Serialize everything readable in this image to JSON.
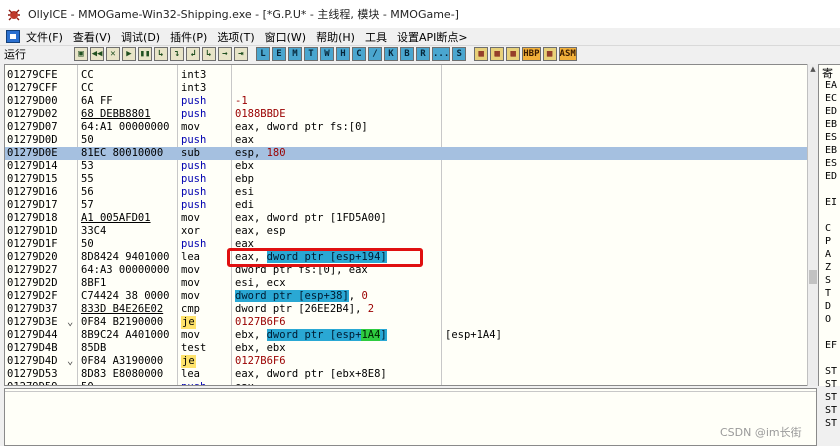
{
  "window": {
    "title": "OllyICE - MMOGame-Win32-Shipping.exe - [*G.P.U* - 主线程, 模块 - MMOGame-]"
  },
  "menu": [
    {
      "id": "file",
      "label": "文件(F)"
    },
    {
      "id": "view",
      "label": "查看(V)"
    },
    {
      "id": "debug",
      "label": "调试(D)"
    },
    {
      "id": "plugins",
      "label": "插件(P)"
    },
    {
      "id": "options",
      "label": "选项(T)"
    },
    {
      "id": "window",
      "label": "窗口(W)"
    },
    {
      "id": "help",
      "label": "帮助(H)"
    },
    {
      "id": "tools",
      "label": "工具"
    },
    {
      "id": "api",
      "label": "设置API断点>"
    }
  ],
  "toolbar": {
    "status": "运行",
    "play_buttons": [
      "▣",
      "◀◀",
      "✕",
      "▶",
      "▮▮",
      "↳",
      "↴",
      "↲",
      "↳",
      "→",
      "⇥"
    ],
    "letter_buttons": [
      "L",
      "E",
      "M",
      "T",
      "W",
      "H",
      "C",
      "/",
      "K",
      "B",
      "R",
      "...",
      "S"
    ],
    "misc_buttons": [
      "▦",
      "▦",
      "▦",
      "HBP",
      "▦",
      "ASM"
    ]
  },
  "disasm": [
    {
      "addr": "01279CFE",
      "arrow": "",
      "hex": "CC",
      "mn": "int3",
      "mn_class": "",
      "ops": [],
      "cmt": ""
    },
    {
      "addr": "01279CFF",
      "arrow": "",
      "hex": "CC",
      "mn": "int3",
      "mn_class": "",
      "ops": [],
      "cmt": ""
    },
    {
      "addr": "01279D00",
      "arrow": "",
      "hex": "6A FF",
      "mn": "push",
      "mn_class": "push",
      "ops": [
        {
          "t": "-1",
          "c": "op-num"
        }
      ],
      "cmt": ""
    },
    {
      "addr": "01279D02",
      "arrow": "",
      "hex": "68 DEBB8801",
      "hex_ul": true,
      "mn": "push",
      "mn_class": "push",
      "ops": [
        {
          "t": "0188BBDE",
          "c": "op-num"
        }
      ],
      "cmt": ""
    },
    {
      "addr": "01279D07",
      "arrow": "",
      "hex": "64:A1 00000000",
      "mn": "mov",
      "mn_class": "",
      "ops": [
        {
          "t": "eax, dword ptr fs:[0]",
          "c": ""
        }
      ],
      "cmt": ""
    },
    {
      "addr": "01279D0D",
      "arrow": "",
      "hex": "50",
      "mn": "push",
      "mn_class": "push",
      "ops": [
        {
          "t": "eax",
          "c": ""
        }
      ],
      "cmt": ""
    },
    {
      "addr": "01279D0E",
      "arrow": "",
      "hex": "81EC 80010000",
      "mn": "sub",
      "mn_class": "",
      "ops": [
        {
          "t": "esp, ",
          "c": ""
        },
        {
          "t": "180",
          "c": "op-num"
        }
      ],
      "cmt": "",
      "selected": true
    },
    {
      "addr": "01279D14",
      "arrow": "",
      "hex": "53",
      "mn": "push",
      "mn_class": "push",
      "ops": [
        {
          "t": "ebx",
          "c": ""
        }
      ],
      "cmt": ""
    },
    {
      "addr": "01279D15",
      "arrow": "",
      "hex": "55",
      "mn": "push",
      "mn_class": "push",
      "ops": [
        {
          "t": "ebp",
          "c": ""
        }
      ],
      "cmt": ""
    },
    {
      "addr": "01279D16",
      "arrow": "",
      "hex": "56",
      "mn": "push",
      "mn_class": "push",
      "ops": [
        {
          "t": "esi",
          "c": ""
        }
      ],
      "cmt": ""
    },
    {
      "addr": "01279D17",
      "arrow": "",
      "hex": "57",
      "mn": "push",
      "mn_class": "push",
      "ops": [
        {
          "t": "edi",
          "c": ""
        }
      ],
      "cmt": ""
    },
    {
      "addr": "01279D18",
      "arrow": "",
      "hex": "A1 005AFD01",
      "hex_ul": true,
      "mn": "mov",
      "mn_class": "",
      "ops": [
        {
          "t": "eax, dword ptr [1FD5A00]",
          "c": ""
        }
      ],
      "cmt": ""
    },
    {
      "addr": "01279D1D",
      "arrow": "",
      "hex": "33C4",
      "mn": "xor",
      "mn_class": "",
      "ops": [
        {
          "t": "eax, esp",
          "c": ""
        }
      ],
      "cmt": ""
    },
    {
      "addr": "01279D1F",
      "arrow": "",
      "hex": "50",
      "mn": "push",
      "mn_class": "push",
      "ops": [
        {
          "t": "eax",
          "c": ""
        }
      ],
      "cmt": ""
    },
    {
      "addr": "01279D20",
      "arrow": "",
      "hex": "8D8424 9401000",
      "mn": "lea",
      "mn_class": "",
      "ops": [
        {
          "t": "eax, ",
          "c": ""
        },
        {
          "t": "dword ptr [esp+194]",
          "c": "op-mem"
        }
      ],
      "cmt": ""
    },
    {
      "addr": "01279D27",
      "arrow": "",
      "hex": "64:A3 00000000",
      "mn": "mov",
      "mn_class": "",
      "ops": [
        {
          "t": "dword ptr fs:[0], eax",
          "c": ""
        }
      ],
      "cmt": ""
    },
    {
      "addr": "01279D2D",
      "arrow": "",
      "hex": "8BF1",
      "mn": "mov",
      "mn_class": "",
      "ops": [
        {
          "t": "esi, ecx",
          "c": ""
        }
      ],
      "cmt": ""
    },
    {
      "addr": "01279D2F",
      "arrow": "",
      "hex": "C74424 38 0000",
      "mn": "mov",
      "mn_class": "",
      "ops": [
        {
          "t": "dword ptr [esp+38]",
          "c": "op-mem"
        },
        {
          "t": ", ",
          "c": ""
        },
        {
          "t": "0",
          "c": "op-num"
        }
      ],
      "cmt": ""
    },
    {
      "addr": "01279D37",
      "arrow": "",
      "hex": "833D B4E26E02",
      "hex_ul": true,
      "mn": "cmp",
      "mn_class": "",
      "ops": [
        {
          "t": "dword ptr [26EE2B4], ",
          "c": ""
        },
        {
          "t": "2",
          "c": "op-num"
        }
      ],
      "cmt": ""
    },
    {
      "addr": "01279D3E",
      "arrow": "⌄",
      "hex": "0F84 B2190000",
      "mn": "je",
      "mn_class": "jmp",
      "ops": [
        {
          "t": "0127B6F6",
          "c": "op-num"
        }
      ],
      "cmt": ""
    },
    {
      "addr": "01279D44",
      "arrow": "",
      "hex": "8B9C24 A401000",
      "mn": "mov",
      "mn_class": "",
      "ops": [
        {
          "t": "ebx, ",
          "c": ""
        },
        {
          "t": "dword ptr [esp+",
          "c": "op-mem"
        },
        {
          "t": "1A4",
          "c": "op-green"
        },
        {
          "t": "]",
          "c": "op-mem"
        }
      ],
      "cmt": "[esp+1A4]"
    },
    {
      "addr": "01279D4B",
      "arrow": "",
      "hex": "85DB",
      "mn": "test",
      "mn_class": "",
      "ops": [
        {
          "t": "ebx, ebx",
          "c": ""
        }
      ],
      "cmt": ""
    },
    {
      "addr": "01279D4D",
      "arrow": "⌄",
      "hex": "0F84 A3190000",
      "mn": "je",
      "mn_class": "jmp",
      "ops": [
        {
          "t": "0127B6F6",
          "c": "op-num"
        }
      ],
      "cmt": ""
    },
    {
      "addr": "01279D53",
      "arrow": "",
      "hex": "8D83 E8080000",
      "mn": "lea",
      "mn_class": "",
      "ops": [
        {
          "t": "eax, dword ptr [ebx+8E8]",
          "c": ""
        }
      ],
      "cmt": ""
    },
    {
      "addr": "01279D59",
      "arrow": "",
      "hex": "50",
      "mn": "push",
      "mn_class": "push",
      "ops": [
        {
          "t": "eax",
          "c": ""
        }
      ],
      "cmt": ""
    }
  ],
  "regs": {
    "title": "寄",
    "names": [
      "EA",
      "EC",
      "ED",
      "EB",
      "ES",
      "EB",
      "ES",
      "ED",
      "",
      "EI",
      "",
      "C",
      "P",
      "A",
      "Z",
      "S",
      "T",
      "D",
      "O",
      "",
      "EF",
      "",
      "ST",
      "ST",
      "ST",
      "ST",
      "ST"
    ]
  },
  "watermark": "CSDN @im长街"
}
